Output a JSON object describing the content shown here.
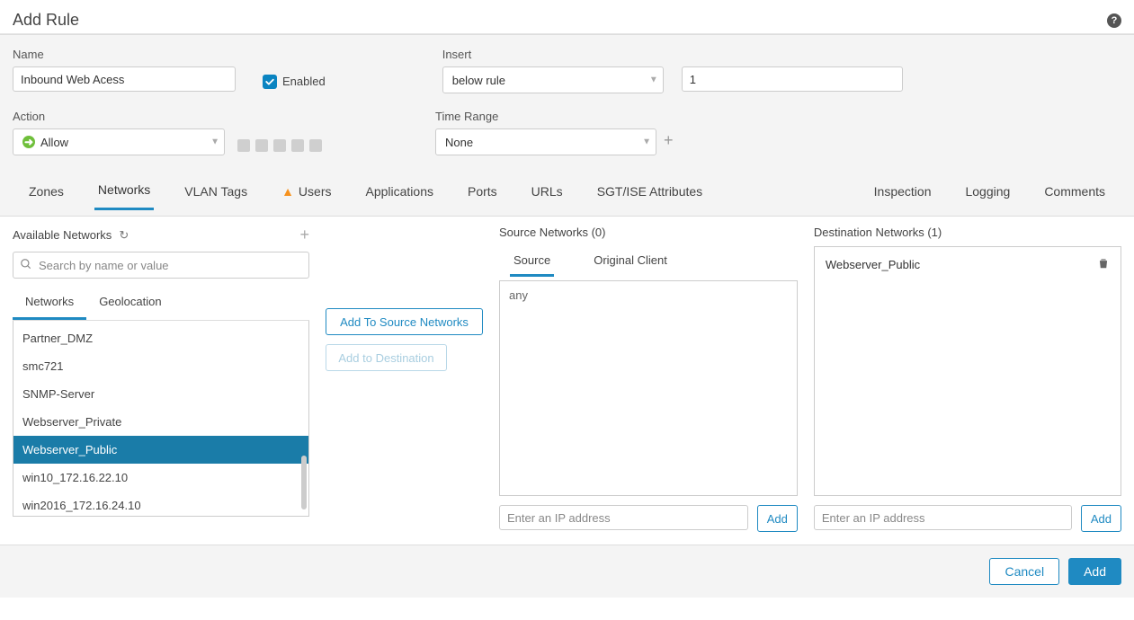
{
  "header": {
    "title": "Add Rule"
  },
  "form": {
    "name_label": "Name",
    "name_value": "Inbound Web Acess",
    "enabled_label": "Enabled",
    "enabled_checked": true,
    "action_label": "Action",
    "action_value": "Allow",
    "insert_label": "Insert",
    "insert_value": "below rule",
    "insert_number": "1",
    "time_range_label": "Time Range",
    "time_range_value": "None"
  },
  "tabs": {
    "left": [
      "Zones",
      "Networks",
      "VLAN Tags",
      "Users",
      "Applications",
      "Ports",
      "URLs",
      "SGT/ISE Attributes"
    ],
    "active_left": "Networks",
    "warn_on": "Users",
    "right": [
      "Inspection",
      "Logging",
      "Comments"
    ]
  },
  "available": {
    "title": "Available Networks",
    "search_placeholder": "Search by name or value",
    "subtabs": [
      "Networks",
      "Geolocation"
    ],
    "active_subtab": "Networks",
    "items": [
      "Partner_DMZ",
      "smc721",
      "SNMP-Server",
      "Webserver_Private",
      "Webserver_Public",
      "win10_172.16.22.10",
      "win2016_172.16.24.10"
    ],
    "selected_item": "Webserver_Public"
  },
  "buttons": {
    "add_source": "Add To Source Networks",
    "add_dest": "Add to Destination"
  },
  "source": {
    "title": "Source Networks (0)",
    "tabs": [
      "Source",
      "Original Client"
    ],
    "active": "Source",
    "value": "any",
    "ip_placeholder": "Enter an IP address",
    "add_label": "Add"
  },
  "destination": {
    "title": "Destination Networks (1)",
    "items": [
      "Webserver_Public"
    ],
    "ip_placeholder": "Enter an IP address",
    "add_label": "Add"
  },
  "footer": {
    "cancel": "Cancel",
    "add": "Add"
  }
}
